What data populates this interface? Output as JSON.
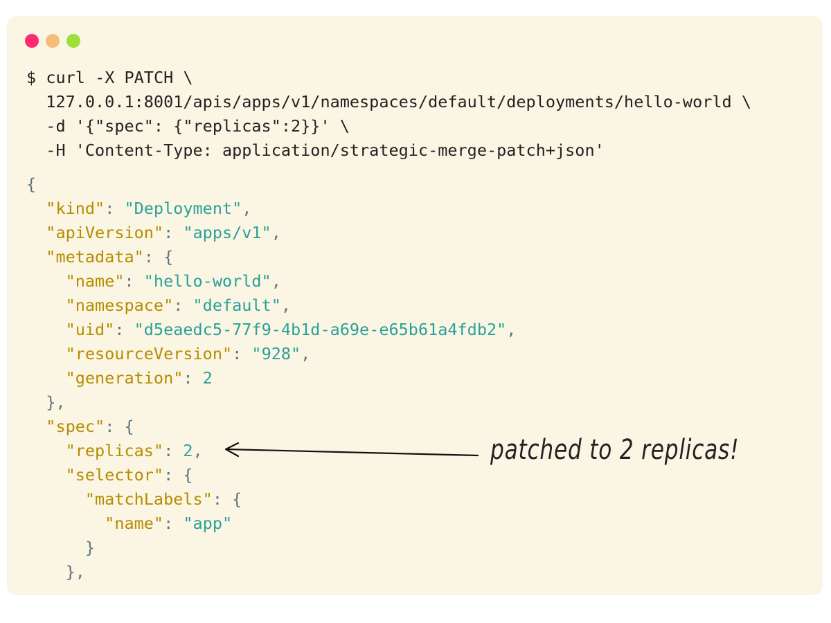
{
  "window": {
    "controls": [
      {
        "name": "close",
        "color": "#fc2b71"
      },
      {
        "name": "minimize",
        "color": "#f5bc7a"
      },
      {
        "name": "maximize",
        "color": "#9be13a"
      }
    ],
    "background": "#fbf5e4"
  },
  "command": {
    "prompt": "$",
    "line1": "curl -X PATCH \\",
    "line2": "127.0.0.1:8001/apis/apps/v1/namespaces/default/deployments/hello-world \\",
    "line3": "-d '{\"spec\": {\"replicas\":2}}' \\",
    "line4": "-H 'Content-Type: application/strategic-merge-patch+json'"
  },
  "response": {
    "open_brace": "{",
    "kind_key": "\"kind\"",
    "kind_value": "\"Deployment\"",
    "apiVersion_key": "\"apiVersion\"",
    "apiVersion_value": "\"apps/v1\"",
    "metadata_key": "\"metadata\"",
    "name_key": "\"name\"",
    "name_value": "\"hello-world\"",
    "namespace_key": "\"namespace\"",
    "namespace_value": "\"default\"",
    "uid_key": "\"uid\"",
    "uid_value": "\"d5eaedc5-77f9-4b1d-a69e-e65b61a4fdb2\"",
    "resourceVersion_key": "\"resourceVersion\"",
    "resourceVersion_value": "\"928\"",
    "generation_key": "\"generation\"",
    "generation_value": "2",
    "spec_key": "\"spec\"",
    "replicas_key": "\"replicas\"",
    "replicas_value": "2",
    "selector_key": "\"selector\"",
    "matchLabels_key": "\"matchLabels\"",
    "label_name_key": "\"name\"",
    "label_name_value": "\"app\""
  },
  "annotation": {
    "text": "patched to 2 replicas!"
  },
  "colors": {
    "key": "#b58c00",
    "string": "#2aa198",
    "punctuation": "#5e7580",
    "command": "#222222"
  }
}
